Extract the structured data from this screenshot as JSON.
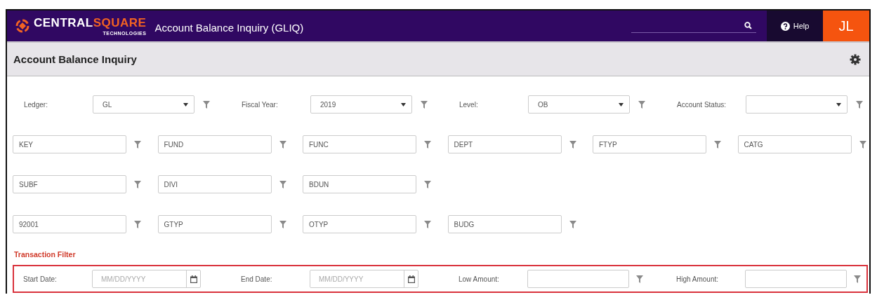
{
  "header": {
    "brand": "CENTRAL",
    "brand_accent": "SQUARE",
    "brand_sub": "TECHNOLOGIES",
    "title": "Account Balance Inquiry (GLIQ)",
    "help": "Help",
    "user_initials": "JL"
  },
  "toolbar": {
    "title": "Account Balance Inquiry"
  },
  "selects": [
    {
      "label": "Ledger:",
      "value": "GL"
    },
    {
      "label": "Fiscal Year:",
      "value": "2019"
    },
    {
      "label": "Level:",
      "value": "OB"
    },
    {
      "label": "Account Status:"
    }
  ],
  "segment_rows": [
    [
      "KEY",
      "FUND",
      "FUNC",
      "DEPT",
      "FTYP",
      "CATG"
    ],
    [
      "SUBF",
      "DIVI",
      "BDUN"
    ],
    [
      "92001",
      "GTYP",
      "OTYP",
      "BUDG"
    ]
  ],
  "transaction_filter": {
    "title": "Transaction Filter",
    "fields": [
      {
        "kind": "date",
        "label": "Start Date:",
        "placeholder": "MM/DD/YYYY"
      },
      {
        "kind": "date",
        "label": "End Date:",
        "placeholder": "MM/DD/YYYY"
      },
      {
        "kind": "amount",
        "label": "Low Amount:"
      },
      {
        "kind": "amount",
        "label": "High Amount:"
      }
    ]
  }
}
